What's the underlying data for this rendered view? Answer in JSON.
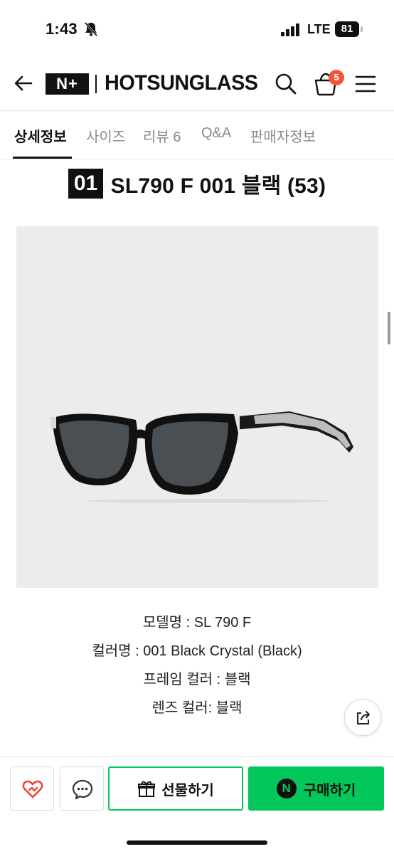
{
  "status_bar": {
    "time": "1:43",
    "network": "LTE",
    "battery": "81"
  },
  "header": {
    "logo_mark": "N+",
    "logo_text": "HOTSUNGLASS",
    "cart_count": "5",
    "icons": [
      "back-arrow-icon",
      "search-icon",
      "cart-icon",
      "menu-icon"
    ]
  },
  "tabs": [
    {
      "label": "상세정보",
      "active": true
    },
    {
      "label": "사이즈"
    },
    {
      "label": "리뷰 6"
    },
    {
      "label": "Q&A"
    },
    {
      "label": "판매자정보"
    }
  ],
  "product": {
    "number": "01",
    "title": "SL790 F 001 블랙 (53)",
    "info": [
      "모델명 : SL 790 F",
      "컬러명 :  001 Black Crystal (Black)",
      "프레임 컬러 : 블랙",
      "렌즈 컬러: 블랙"
    ]
  },
  "bottom_bar": {
    "gift_label": "선물하기",
    "buy_badge": "N",
    "buy_label": "구매하기",
    "accent_color": "#03c75a"
  }
}
